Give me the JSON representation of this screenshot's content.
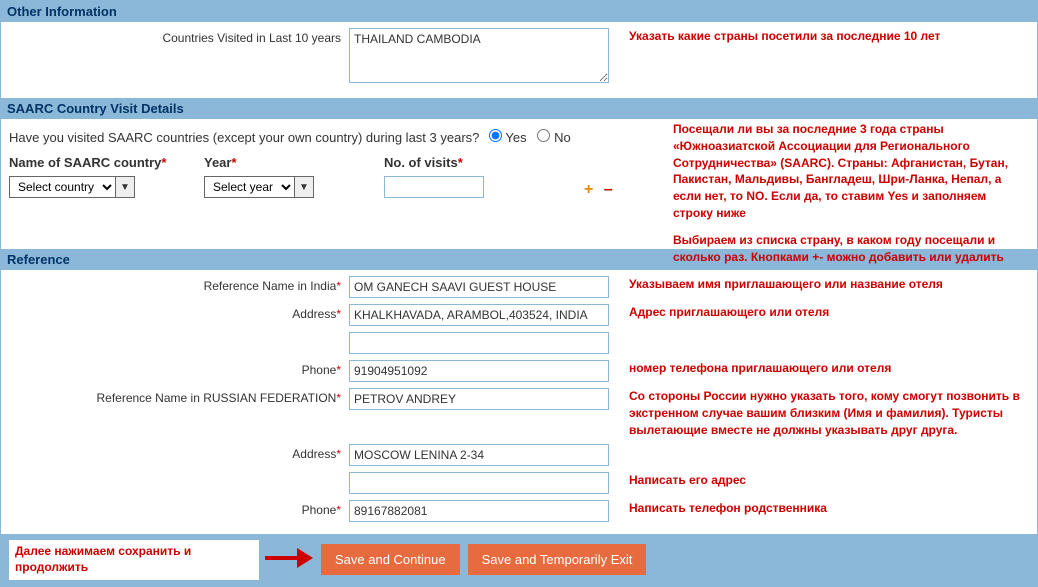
{
  "sections": {
    "other_info": "Other Information",
    "saarc": "SAARC Country Visit Details",
    "reference": "Reference"
  },
  "other_info": {
    "countries_label": "Countries Visited in Last 10 years",
    "countries_value": "THAILAND CAMBODIA",
    "countries_note": "Указать какие страны посетили за последние 10 лет"
  },
  "saarc": {
    "question": "Have you visited SAARC countries (except your own country) during last 3 years?",
    "yes": "Yes",
    "no": "No",
    "note1": "Посещали ли вы за последние 3 года страны «Южноазиатской Ассоциации для Регионального Сотрудничества» (SAARC). Страны: Афганистан, Бутан, Пакистан, Мальдивы, Бангладеш, Шри-Ланка, Непал, а если нет, то NO. Если да, то ставим Yes и заполняем строку ниже",
    "note2": "Выбираем из списка страну, в каком году посещали и сколько раз. Кнопками +- можно добавить или удалить",
    "country_label": "Name of SAARC country",
    "country_placeholder": "Select country",
    "year_label": "Year",
    "year_placeholder": "Select year",
    "visits_label": "No. of visits",
    "plus": "+",
    "minus": "–"
  },
  "reference": {
    "name_india_label": "Reference Name in India",
    "name_india_value": "OM GANECH SAAVI GUEST HOUSE",
    "name_india_note": "Указываем имя приглашающего или название отеля",
    "address_label": "Address",
    "address_india_value": "KHALKHAVADA, ARAMBOL,403524, INDIA",
    "address_india_note": "Адрес приглашающего или  отеля",
    "phone_label": "Phone",
    "phone_india_value": "91904951092",
    "phone_india_note": "номер телефона приглашающего или отеля",
    "name_home_label": "Reference Name in RUSSIAN FEDERATION",
    "name_home_value": "PETROV ANDREY",
    "name_home_note": "Со стороны России нужно указать того, кому смогут позвонить в экстренном случае вашим близким (Имя и фамилия). Туристы вылетающие вместе не должны указывать друг друга.",
    "address_home_value": "MOSCOW LENINA 2-34",
    "address_home_note": "Написать его адрес",
    "phone_home_value": "89167882081",
    "phone_home_note": "Написать телефон родственника"
  },
  "buttons": {
    "save_continue": "Save and Continue",
    "save_exit": "Save and Temporarily Exit",
    "footer_note": "Далее нажимаем сохранить и продолжить"
  }
}
